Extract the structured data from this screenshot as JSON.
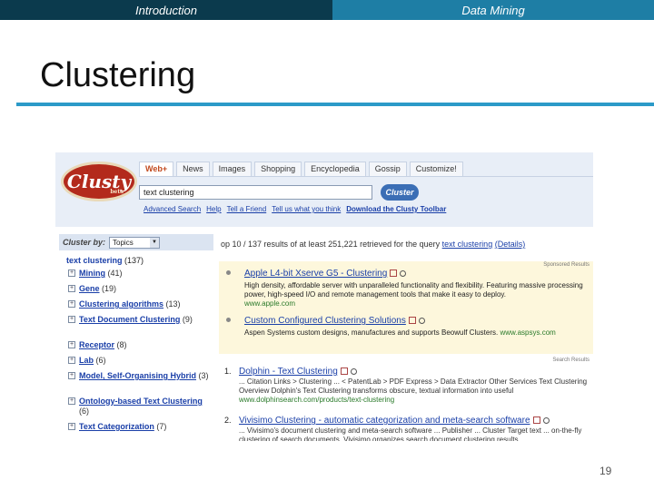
{
  "slide": {
    "topbar_left": "Introduction",
    "topbar_right": "Data Mining",
    "title": "Clustering",
    "page_number": "19"
  },
  "clusty": {
    "logo": "Clusty",
    "logo_sub": "beta",
    "tabs": [
      "Web+",
      "News",
      "Images",
      "Shopping",
      "Encyclopedia",
      "Gossip",
      "Customize!"
    ],
    "search_value": "text clustering",
    "search_button": "Cluster",
    "links": [
      "Advanced Search",
      "Help",
      "Tell a Friend",
      "Tell us what you think",
      "Download the Clusty Toolbar"
    ],
    "clusterby_label": "Cluster by:",
    "clusterby_value": "Topics",
    "root_label": "text clustering",
    "root_count": "(137)",
    "clusters": [
      {
        "name": "Mining",
        "count": "(41)"
      },
      {
        "name": "Gene",
        "count": "(19)"
      },
      {
        "name": "Clustering algorithms",
        "count": "(13)"
      },
      {
        "name": "Text Document Clustering",
        "count": "(9)"
      },
      {
        "name": "Receptor",
        "count": "(8)"
      },
      {
        "name": "Lab",
        "count": "(6)"
      },
      {
        "name": "Model, Self-Organising Hybrid",
        "count": "(3)"
      },
      {
        "name": "Ontology-based Text Clustering",
        "count": "(6)"
      },
      {
        "name": "Text Categorization",
        "count": "(7)"
      }
    ],
    "summary_text": "op 10 / 137 results of at least 251,221 retrieved for the query",
    "summary_query": "text clustering",
    "summary_details": "(Details)",
    "sponsored_label": "Sponsored Results",
    "ads": [
      {
        "title": "Apple L4-bit Xserve G5 - Clustering",
        "desc": "High density, affordable server with unparalleled functionality and flexibility. Featuring massive processing power, high-speed I/O and remote management tools that make it easy to deploy.",
        "url": "www.apple.com"
      },
      {
        "title": "Custom Configured Clustering Solutions",
        "desc": "Aspen Systems custom designs, manufactures and supports Beowulf Clusters.",
        "url": "www.aspsys.com"
      }
    ],
    "search_results_label": "Search Results",
    "results": [
      {
        "num": "1.",
        "title": "Dolphin - Text Clustering",
        "desc": "... Citation Links > Clustering ... < PatentLab > PDF Express > Data Extractor Other Services Text Clustering Overview Dolphin's Text Clustering transforms obscure, textual information into useful",
        "url": "www.dolphinsearch.com/products/text-clustering"
      },
      {
        "num": "2.",
        "title": "Vivisimo Clustering - automatic categorization and meta-search software",
        "desc": "... Vivisimo's document clustering and meta-search software ... Publisher ... Cluster Target text ... on-the-fly clustering of search documents. Vivisimo organizes search document clustering results",
        "url": ""
      }
    ]
  }
}
